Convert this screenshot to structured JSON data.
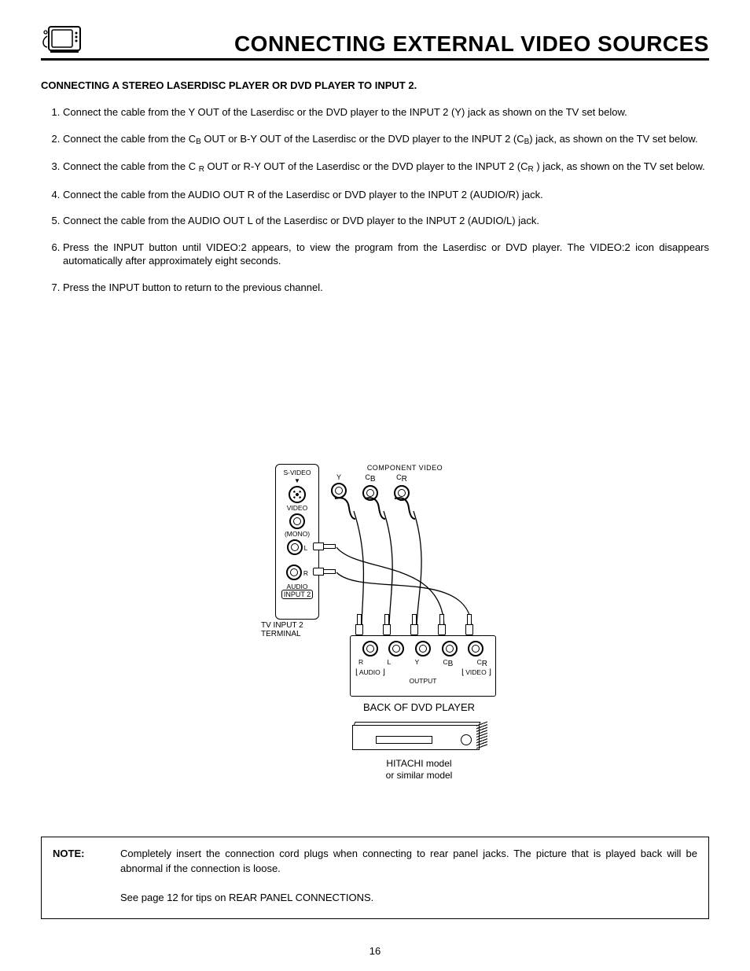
{
  "header": {
    "title": "CONNECTING EXTERNAL VIDEO SOURCES"
  },
  "subtitle": "CONNECTING A STEREO LASERDISC PLAYER OR DVD PLAYER TO INPUT 2.",
  "steps": [
    {
      "pre": "Connect  the cable from the Y OUT of the Laserdisc or the DVD player to the INPUT 2 (Y) jack as shown on the TV set below."
    },
    {
      "pre": "Connect the cable from the C",
      "sub1": "B",
      "mid": "  OUT or B-Y OUT of the Laserdisc or the DVD player to the INPUT 2 (C",
      "sub2": "B",
      "post": ") jack, as shown on the TV set below."
    },
    {
      "pre": "Connect the cable from the C ",
      "sub1": "R",
      "mid": " OUT or R-Y OUT of the Laserdisc or the DVD player to the INPUT 2 (C",
      "sub2": "R",
      "post": " ) jack, as shown on the TV set below."
    },
    {
      "pre": "Connect the cable from the AUDIO OUT R of the Laserdisc or DVD player to the INPUT 2 (AUDIO/R) jack."
    },
    {
      "pre": "Connect the cable from the AUDIO OUT L of the Laserdisc or DVD player to the INPUT 2 (AUDIO/L) jack."
    },
    {
      "pre": "Press the INPUT button until VIDEO:2 appears, to view the program from the Laserdisc or DVD player.  The VIDEO:2 icon disappears automatically after approximately eight seconds."
    },
    {
      "pre": "Press the INPUT button to return to the previous channel."
    }
  ],
  "diagram": {
    "tv_panel": {
      "svideo": "S-VIDEO",
      "video": "VIDEO",
      "mono": "(MONO)",
      "audio": "AUDIO",
      "l": "L",
      "r": "R",
      "input2": "INPUT 2",
      "component_header": "COMPONENT VIDEO",
      "y": "Y",
      "cb": "C",
      "cb_sub": "B",
      "cr": "C",
      "cr_sub": "R",
      "terminal_label_1": "TV INPUT 2",
      "terminal_label_2": "TERMINAL"
    },
    "dvd_panel": {
      "r": "R",
      "l": "L",
      "y": "Y",
      "cb": "C",
      "cb_sub": "B",
      "cr": "C",
      "cr_sub": "R",
      "audio": "AUDIO",
      "video": "VIDEO",
      "output": "OUTPUT",
      "caption": "BACK OF DVD PLAYER",
      "sub1": "HITACHI model",
      "sub2": "or similar model"
    }
  },
  "note": {
    "label": "NOTE:",
    "text": "Completely insert the connection cord plugs when connecting to rear panel jacks.  The picture that is played back will be abnormal if the connection is loose.",
    "sub": "See page 12 for tips on REAR PANEL CONNECTIONS."
  },
  "page_number": "16"
}
